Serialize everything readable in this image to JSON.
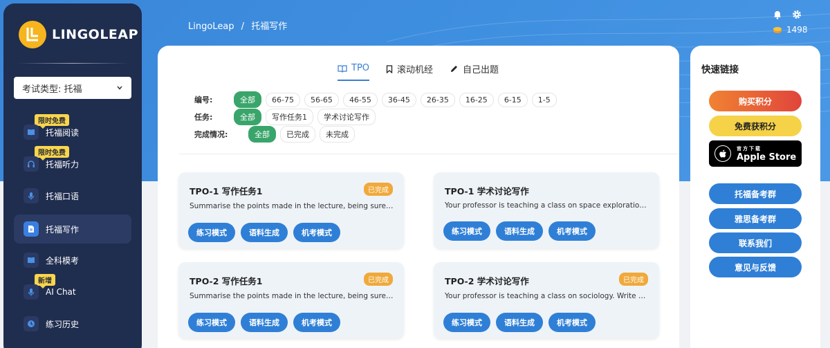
{
  "brand": {
    "name": "LINGOLEAP"
  },
  "sidebar": {
    "exam_select": "考试类型: 托福",
    "items": [
      {
        "label": "托福阅读",
        "badge": "限时免费"
      },
      {
        "label": "托福听力",
        "badge": "限时免费"
      },
      {
        "label": "托福口语"
      },
      {
        "label": "托福写作"
      },
      {
        "label": "全科模考"
      },
      {
        "label": "AI Chat",
        "badge": "新增"
      },
      {
        "label": "练习历史"
      }
    ]
  },
  "header": {
    "breadcrumb": [
      "LingoLeap",
      "/",
      "托福写作"
    ],
    "points": "1498"
  },
  "tabs": [
    {
      "label": "TPO"
    },
    {
      "label": "滚动机经"
    },
    {
      "label": "自己出题"
    }
  ],
  "filters": {
    "number": {
      "label": "编号:",
      "options": [
        "全部",
        "66-75",
        "56-65",
        "46-55",
        "36-45",
        "26-35",
        "16-25",
        "6-15",
        "1-5"
      ]
    },
    "task": {
      "label": "任务:",
      "options": [
        "全部",
        "写作任务1",
        "学术讨论写作"
      ]
    },
    "status": {
      "label": "完成情况:",
      "options": [
        "全部",
        "已完成",
        "未完成"
      ]
    }
  },
  "cards": [
    {
      "title": "TPO-1 写作任务1",
      "status": "已完成",
      "desc": "Summarise the points made in the lecture, being sure to explain how they cast doubt",
      "buttons": [
        "练习模式",
        "语料生成",
        "机考模式"
      ]
    },
    {
      "title": "TPO-1 学术讨论写作",
      "status": "",
      "desc": "Your professor is teaching a class on space exploration. Write a post responding",
      "buttons": [
        "练习模式",
        "语料生成",
        "机考模式"
      ]
    },
    {
      "title": "TPO-2 写作任务1",
      "status": "已完成",
      "desc": "Summarise the points made in the lecture, being sure to explain how they cast doubt",
      "buttons": [
        "练习模式",
        "语料生成",
        "机考模式"
      ]
    },
    {
      "title": "TPO-2 学术讨论写作",
      "status": "已完成",
      "desc": "Your professor is teaching a class on sociology. Write a post responding",
      "buttons": [
        "练习模式",
        "语料生成",
        "机考模式"
      ]
    }
  ],
  "quick_links": {
    "title": "快速链接",
    "buy": "购买积分",
    "free": "免费获积分",
    "apple_small": "官方下载",
    "apple_big": "Apple Store",
    "groups": [
      "托福备考群",
      "雅思备考群",
      "联系我们",
      "意见与反馈"
    ]
  },
  "colors": {
    "primary": "#2f7fd6",
    "sidebar": "#1f2d4f",
    "chip_active": "#3aa56b",
    "status": "#f0a93a",
    "badge": "#f8d64e"
  }
}
